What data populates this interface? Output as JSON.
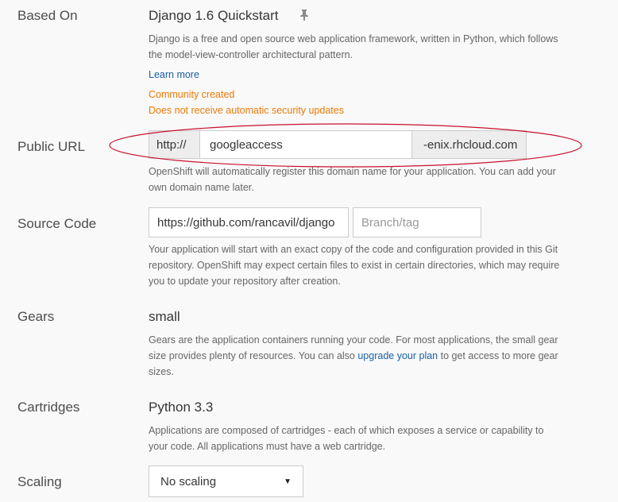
{
  "based_on": {
    "label": "Based On",
    "title": "Django 1.6 Quickstart",
    "icon": "pin-icon",
    "description": "Django is a free and open source web application framework, written in Python, which follows the model-view-controller architectural pattern.",
    "learn_more": "Learn more",
    "community": "Community created",
    "no_updates": "Does not receive automatic security updates"
  },
  "public_url": {
    "label": "Public URL",
    "prefix": "http://",
    "value": "googleaccess",
    "suffix": "-enix.rhcloud.com",
    "help": "OpenShift will automatically register this domain name for your application. You can add your own domain name later."
  },
  "source_code": {
    "label": "Source Code",
    "repo_value": "https://github.com/rancavil/django",
    "branch_placeholder": "Branch/tag",
    "help": "Your application will start with an exact copy of the code and configuration provided in this Git repository. OpenShift may expect certain files to exist in certain directories, which may require you to update your repository after creation."
  },
  "gears": {
    "label": "Gears",
    "value": "small",
    "help_before": "Gears are the application containers running your code. For most applications, the small gear size provides plenty of resources. You can also ",
    "help_link": "upgrade your plan",
    "help_after": " to get access to more gear sizes."
  },
  "cartridges": {
    "label": "Cartridges",
    "value": "Python 3.3",
    "help": "Applications are composed of cartridges - each of which exposes a service or capability to your code. All applications must have a web cartridge."
  },
  "scaling": {
    "label": "Scaling",
    "selected": "No scaling"
  },
  "colors": {
    "link": "#1b5fa8",
    "warning": "#ec7a08",
    "annotation": "#c8102e"
  }
}
